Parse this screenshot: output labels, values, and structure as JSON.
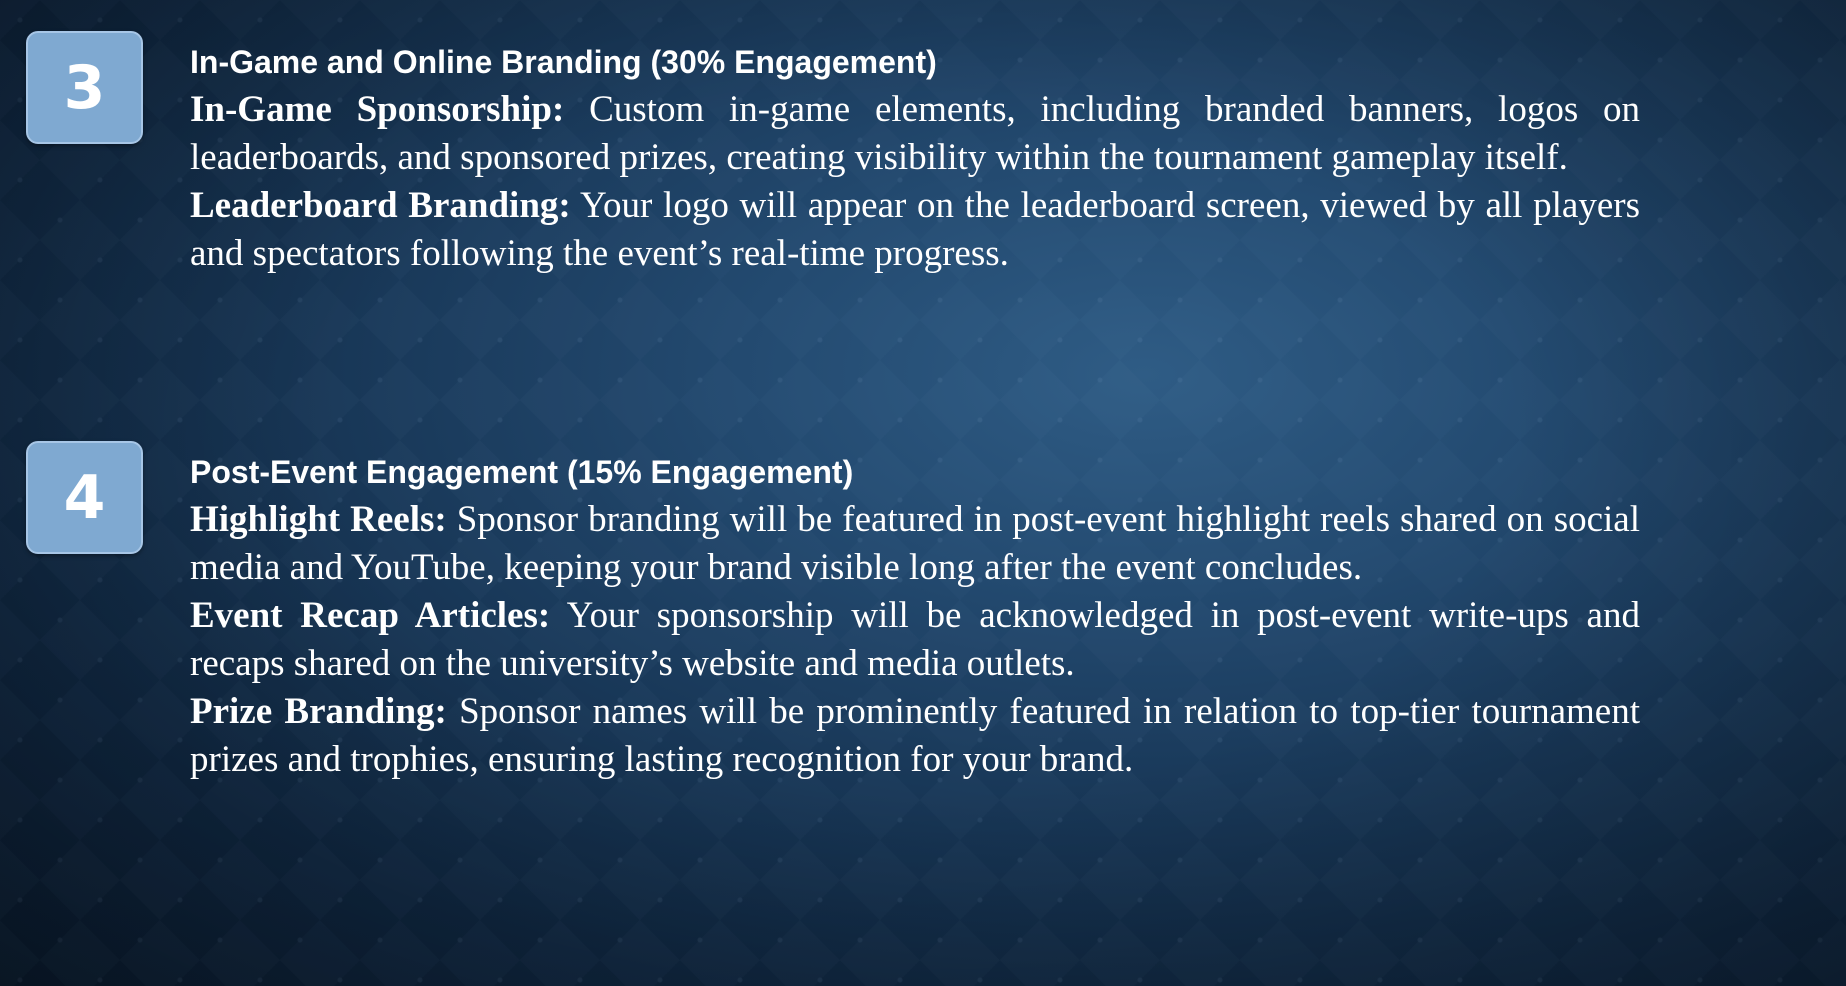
{
  "sections": [
    {
      "number": "3",
      "heading": "In-Game and Online Branding (30% Engagement)",
      "items": [
        {
          "term": "In-Game Sponsorship:",
          "text": " Custom in-game elements, including branded banners, logos on leaderboards, and sponsored prizes, creating visibility within the tournament gameplay itself."
        },
        {
          "term": "Leaderboard Branding:",
          "text": " Your logo will appear on the leaderboard screen, viewed by all players and spectators following the event’s real-time progress."
        }
      ]
    },
    {
      "number": "4",
      "heading": "Post-Event Engagement (15% Engagement)",
      "items": [
        {
          "term": "Highlight Reels:",
          "text": " Sponsor branding will be featured in post-event highlight reels shared on social media and YouTube, keeping your brand visible long after the event concludes."
        },
        {
          "term": "Event Recap Articles:",
          "text": " Your sponsorship will be acknowledged in post-event write-ups and recaps shared on the university’s website and media outlets."
        },
        {
          "term": "Prize Branding:",
          "text": " Sponsor names will be prominently featured in relation to top-tier tournament prizes and trophies, ensuring lasting recognition for your brand."
        }
      ]
    }
  ],
  "colors": {
    "background_center": "#2f5c85",
    "background_edge": "#0a1a2d",
    "badge_fill": "#7fa9d1",
    "badge_border": "#a7c6e6",
    "text": "#ffffff"
  }
}
